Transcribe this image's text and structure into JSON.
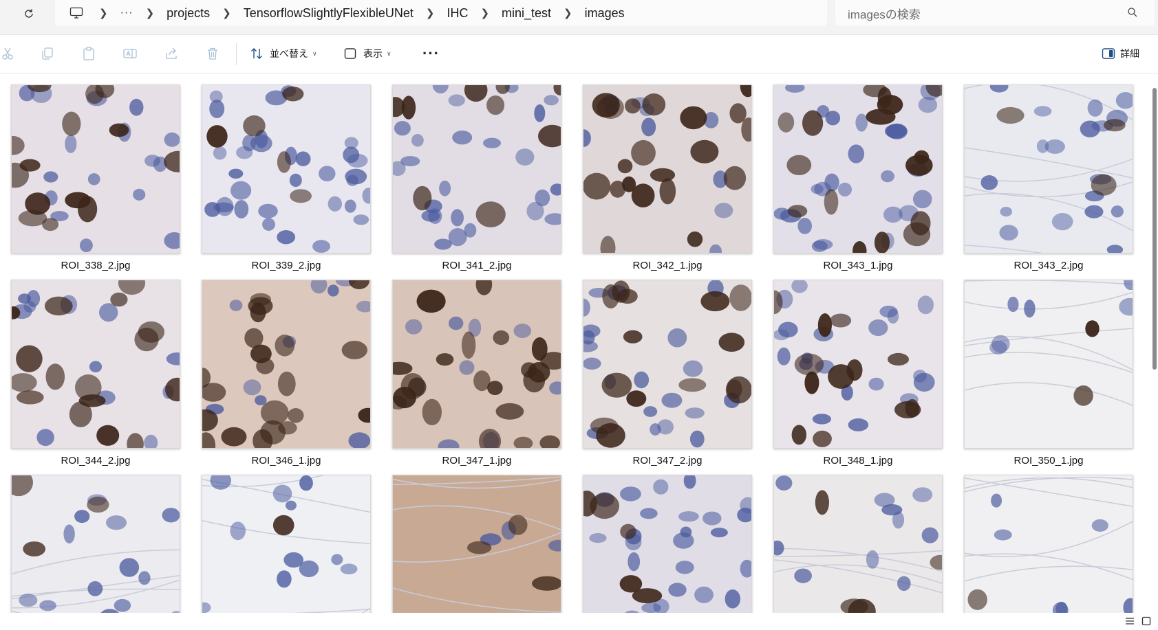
{
  "address_bar": {
    "refresh_icon": "refresh-icon",
    "pc_icon": "computer-icon",
    "overflow": "···",
    "crumbs": [
      "projects",
      "TensorflowSlightlyFlexibleUNet",
      "IHC",
      "mini_test",
      "images"
    ]
  },
  "search": {
    "placeholder": "imagesの検索",
    "icon": "search-icon"
  },
  "toolbar": {
    "icons": [
      "cut-icon",
      "copy-icon",
      "paste-icon",
      "rename-icon",
      "share-icon",
      "delete-icon"
    ],
    "sort_label": "並べ替え",
    "view_label": "表示",
    "more_label": "···",
    "details_label": "詳細"
  },
  "files": [
    {
      "name": "ROI_338_2.jpg"
    },
    {
      "name": "ROI_339_2.jpg"
    },
    {
      "name": "ROI_341_2.jpg"
    },
    {
      "name": "ROI_342_1.jpg"
    },
    {
      "name": "ROI_343_1.jpg"
    },
    {
      "name": "ROI_343_2.jpg"
    },
    {
      "name": "ROI_344_2.jpg"
    },
    {
      "name": "ROI_346_1.jpg"
    },
    {
      "name": "ROI_347_1.jpg"
    },
    {
      "name": "ROI_347_2.jpg"
    },
    {
      "name": "ROI_348_1.jpg"
    },
    {
      "name": "ROI_350_1.jpg"
    },
    {
      "name": ""
    },
    {
      "name": ""
    },
    {
      "name": ""
    },
    {
      "name": ""
    },
    {
      "name": ""
    },
    {
      "name": ""
    }
  ],
  "colors": {
    "hematoxylin": "#4a5a9e",
    "dab": "#3b2418",
    "background": "#e7e2e4",
    "accent": "#005fb8"
  }
}
